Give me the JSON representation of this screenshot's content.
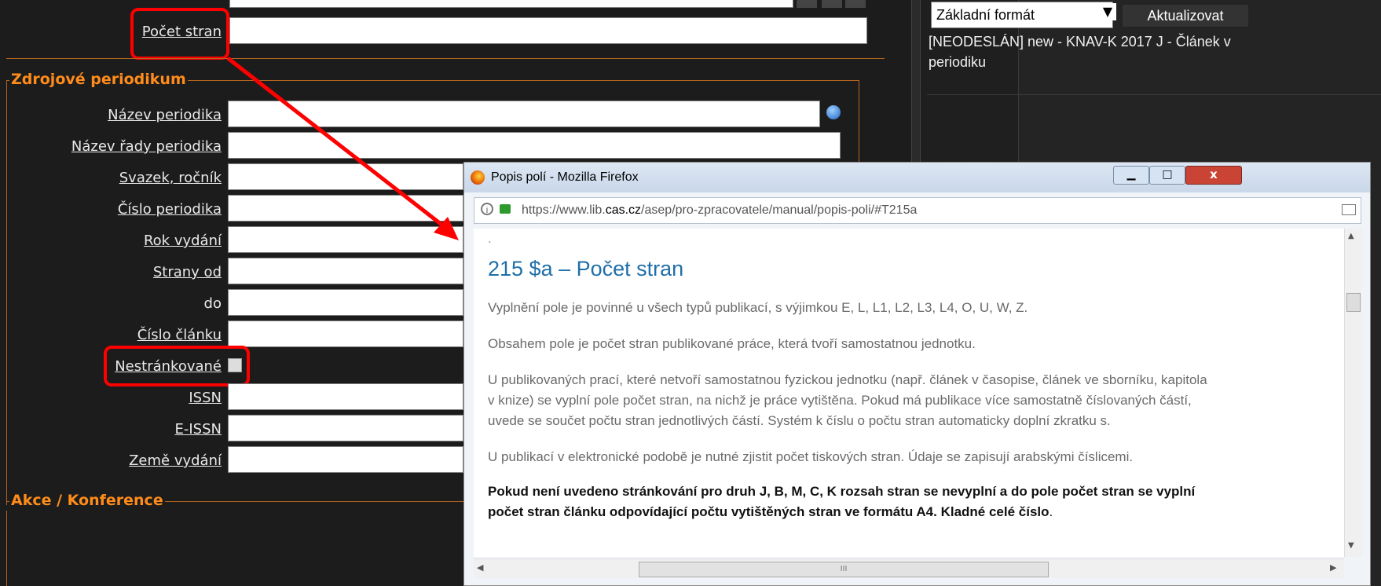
{
  "form": {
    "pocet_stran_label": "Počet stran",
    "section_zdrojove": "Zdrojové periodikum",
    "fields": {
      "nazev_periodika": "Název periodika",
      "nazev_rady": "Název řady periodika",
      "svazek": "Svazek, ročník",
      "cislo_periodika": "Číslo periodika",
      "rok_vydani": "Rok vydání",
      "strany_od": "Strany od",
      "do": "do",
      "cislo_clanku": "Číslo článku",
      "nestrankovane": "Nestránkované",
      "issn": "ISSN",
      "eissn": "E-ISSN",
      "zeme_vydani": "Země vydání"
    },
    "section_akce": "Akce / Konference"
  },
  "right_panel": {
    "format_select": "Základní formát",
    "update_button": "Aktualizovat",
    "record_line1": "[NEODESLÁN] new - KNAV-K 2017 J - Článek v",
    "record_line2": "periodiku"
  },
  "firefox": {
    "window_title": "Popis polí - Mozilla Firefox",
    "url_prefix": "https://www.lib.",
    "url_domain": "cas.cz",
    "url_suffix": "/asep/pro-zpracovatele/manual/popis-poli/#T215a",
    "dot": ".",
    "heading": "215 $a – Počet stran",
    "p1": "Vyplnění pole je povinné u všech typů publikací, s výjimkou E, L, L1, L2, L3, L4, O, U, W, Z.",
    "p2": "Obsahem pole je počet stran publikované práce, která tvoří samostatnou jednotku.",
    "p3_l1": "U publikovaných prací, které netvoří samostatnou fyzickou jednotku (např. článek v časopise, článek ve sborníku, kapitola",
    "p3_l2": "v knize) se vyplní pole počet stran, na nichž je práce vytištěna. Pokud má publikace více samostatně číslovaných částí,",
    "p3_l3": "uvede se součet počtu stran jednotlivých částí. Systém k číslu o počtu stran automaticky doplní zkratku s.",
    "p4": "U publikací v elektronické podobě je nutné zjistit počet tiskových stran. Údaje se zapisují arabskými číslicemi.",
    "p5_l1": "Pokud není uvedeno stránkování pro druh J, B, M, C, K rozsah stran se nevyplní a do pole počet stran se vyplní",
    "p5_l2": "počet stran článku odpovídající počtu vytištěných stran ve formátu A4. Kladné celé číslo",
    "p5_end": ".",
    "hscroll_grip": "III"
  }
}
